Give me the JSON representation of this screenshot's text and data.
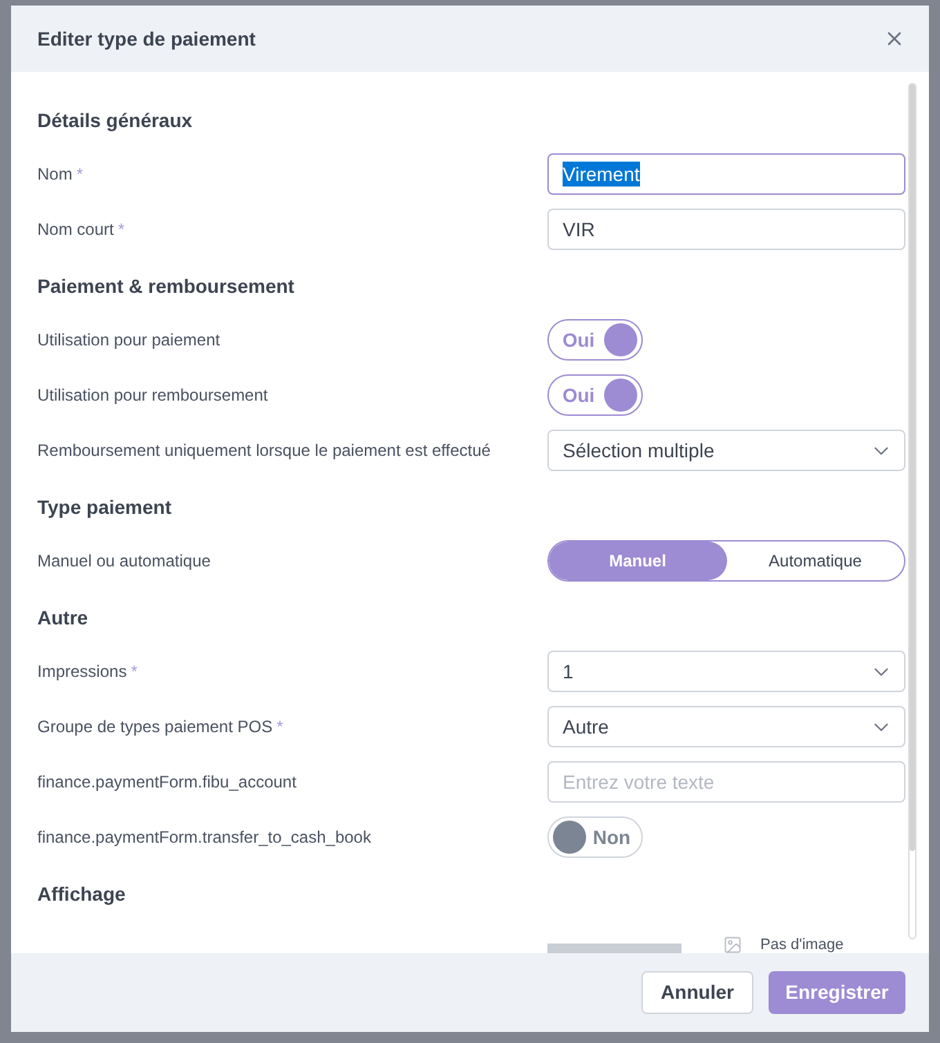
{
  "dialog": {
    "title": "Editer type de paiement"
  },
  "sections": [
    {
      "title": "Détails généraux",
      "fields": [
        {
          "kind": "text",
          "label": "Nom",
          "required_mark": "*",
          "value": "Virement",
          "focused": true,
          "text_selected": true
        },
        {
          "kind": "text",
          "label": "Nom court",
          "required_mark": "*",
          "value": "VIR",
          "focused": false
        }
      ]
    },
    {
      "title": "Paiement & remboursement",
      "fields": [
        {
          "kind": "toggle",
          "label": "Utilisation pour paiement",
          "on": true,
          "text": "Oui"
        },
        {
          "kind": "toggle",
          "label": "Utilisation pour remboursement",
          "on": true,
          "text": "Oui"
        },
        {
          "kind": "select",
          "label": "Remboursement uniquement lorsque le paiement est effectué",
          "value": "Sélection multiple"
        }
      ]
    },
    {
      "title": "Type paiement",
      "fields": [
        {
          "kind": "segmented",
          "label": "Manuel ou automatique",
          "options": [
            {
              "label": "Manuel",
              "selected": true
            },
            {
              "label": "Automatique",
              "selected": false
            }
          ]
        }
      ]
    },
    {
      "title": "Autre",
      "fields": [
        {
          "kind": "select",
          "label": "Impressions",
          "required_mark": "*",
          "value": "1"
        },
        {
          "kind": "select",
          "label": "Groupe de types paiement POS",
          "required_mark": "*",
          "value": "Autre"
        },
        {
          "kind": "text",
          "label": "finance.paymentForm.fibu_account",
          "placeholder": "Entrez votre texte",
          "focused": false
        },
        {
          "kind": "toggle",
          "label": "finance.paymentForm.transfer_to_cash_book",
          "on": false,
          "text": "Non"
        }
      ]
    },
    {
      "title": "Affichage",
      "fields": [
        {
          "kind": "image",
          "empty_text": "Pas d'image"
        }
      ]
    }
  ],
  "buttons": [
    {
      "label": "Annuler",
      "kind": "secondary"
    },
    {
      "label": "Enregistrer",
      "kind": "primary"
    }
  ]
}
